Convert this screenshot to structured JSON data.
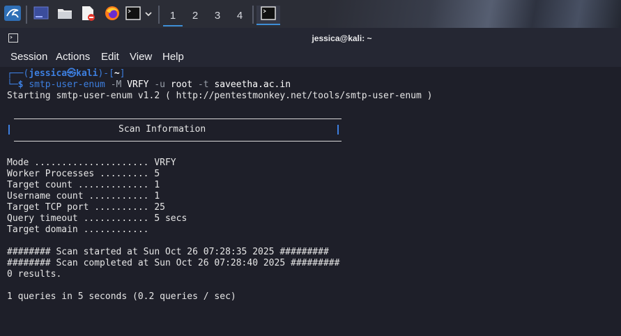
{
  "panel": {
    "workspaces": [
      "1",
      "2",
      "3",
      "4"
    ],
    "icons": [
      "kali-menu-icon",
      "show-desktop-icon",
      "file-manager-icon",
      "text-editor-icon",
      "firefox-icon",
      "terminal-launcher-icon",
      "chevron-down-icon",
      "terminal-window-icon"
    ]
  },
  "window": {
    "title": "jessica@kali: ~"
  },
  "menu": [
    "Session",
    "Actions",
    "Edit",
    "View",
    "Help"
  ],
  "terminal": {
    "prompt_user": "jessica",
    "prompt_at": "㉿",
    "prompt_host": "kali",
    "prompt_dir": "~",
    "cmd_name": "smtp-user-enum",
    "cmd_opt1": "-M",
    "cmd_val1": "VRFY",
    "cmd_opt2": "-u",
    "cmd_val2": "root",
    "cmd_opt3": "-t",
    "cmd_val3": "saveetha.ac.in",
    "starting": "Starting smtp-user-enum v1.2 ( http://pentestmonkey.net/tools/smtp-user-enum )",
    "scan_info_title": "Scan Information",
    "info": [
      "Mode ..................... VRFY",
      "Worker Processes ......... 5",
      "Target count ............. 1",
      "Username count ........... 1",
      "Target TCP port .......... 25",
      "Query timeout ............ 5 secs",
      "Target domain ............"
    ],
    "scan_started": "######## Scan started at Sun Oct 26 07:28:35 2025 #########",
    "scan_completed": "######## Scan completed at Sun Oct 26 07:28:40 2025 #########",
    "results": "0 results.",
    "queries": "1 queries in 5 seconds (0.2 queries / sec)"
  }
}
